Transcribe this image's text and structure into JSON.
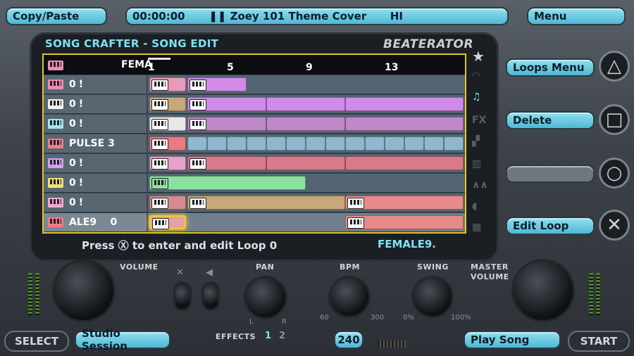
{
  "top": {
    "left_button": "Copy/Paste",
    "time": "00:00:00",
    "song_title": "Zoey 101 Theme Cover",
    "song_tag": "HI",
    "menu": "Menu"
  },
  "panel": {
    "title": "SONG CRAFTER - SONG EDIT",
    "logo": "BEATERATOR",
    "header_label": "FEMA",
    "ruler_numbers": [
      "1",
      "5",
      "9",
      "13"
    ],
    "hint": "Press Ⓧ to enter and edit Loop 0",
    "loop_name": "FEMALE9."
  },
  "tracks": [
    {
      "label": "0",
      "color": "#f08ab0"
    },
    {
      "label": "0",
      "color": "#f0f0f0"
    },
    {
      "label": "0",
      "color": "#9fe6f4"
    },
    {
      "label": "PULSE 3",
      "color": "#f07a8a"
    },
    {
      "label": "0",
      "color": "#d6a0f0"
    },
    {
      "label": "0",
      "color": "#f0e07a"
    },
    {
      "label": "0",
      "color": "#f0a8d0"
    },
    {
      "label": "ALE9    0",
      "color": "#f07a8a"
    }
  ],
  "right_menu": {
    "loops_menu": "Loops Menu",
    "delete": "Delete",
    "edit_loop": "Edit Loop"
  },
  "bottom": {
    "select": "SELECT",
    "studio_session": "Studio Session",
    "volume": "VOLUME",
    "pan": "PAN",
    "pan_l": "L",
    "pan_r": "R",
    "effects": "EFFECTS",
    "fx1": "1",
    "fx2": "2",
    "bpm": "BPM",
    "bpm_min": "60",
    "bpm_max": "300",
    "bpm_value": "240",
    "swing": "SWING",
    "swing_min": "0%",
    "swing_max": "100%",
    "master_volume_1": "MASTER",
    "master_volume_2": "VOLUME",
    "play_song": "Play Song",
    "start": "START"
  },
  "colors": {
    "accent": "#7fe0f4",
    "highlight": "#e7c526"
  }
}
